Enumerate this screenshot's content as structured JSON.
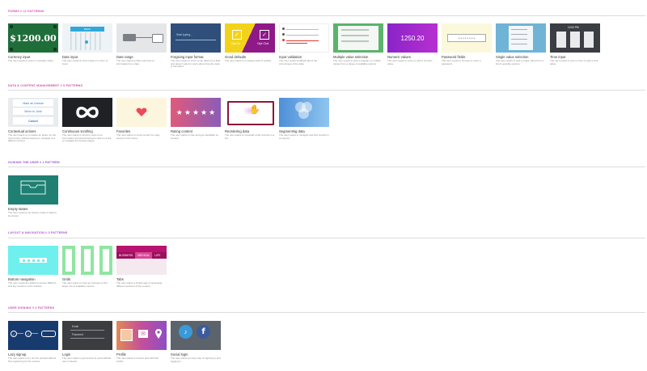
{
  "colors": {
    "section_forms": "#d44fb8",
    "section_data": "#cc4f9e",
    "section_empty": "#9c4ed0",
    "section_layout": "#b04fd0",
    "section_social": "#cc4fb8",
    "rule": "#dcdcdc"
  },
  "sections": {
    "forms": {
      "title": "FORMS // 11 PATTERNS",
      "cards": [
        {
          "title": "Currency input",
          "desc": "The user needs to enter a monetary value.",
          "thumb_text": "$1200.00"
        },
        {
          "title": "Date input",
          "desc": "The user needs to pick a date on a form or input.",
          "thumb_text": "March"
        },
        {
          "title": "Date range",
          "desc": "The user wants to filter and look up information by a date.",
          "thumb_text": ""
        },
        {
          "title": "Forgiving input format",
          "desc": "The user needs to enter some data into a field and doesn't want to worry about how the data is formatted.",
          "thumb_text": "Start typing..."
        },
        {
          "title": "Good defaults",
          "desc": "The user wants to complete actions quickly.",
          "thumb_left": "Opt-in",
          "thumb_right": "Opt Out"
        },
        {
          "title": "Input validation",
          "desc": "The user needs feedback about the correctness of the data.",
          "thumb_text": ""
        },
        {
          "title": "Multiple value selection",
          "desc": "The user needs to pick a singular or multiple values from a range of available options.",
          "thumb_text": ""
        },
        {
          "title": "Numeric values",
          "desc": "The user needs to enter or pick a numeric value.",
          "thumb_text": "1250.20"
        },
        {
          "title": "Password fields",
          "desc": "The user needs to choose or enter a password.",
          "thumb_text": "* * * * * * * *"
        },
        {
          "title": "Single value selection",
          "desc": "The user needs to pick a single value from a list of possible options.",
          "thumb_text": ""
        },
        {
          "title": "Time input",
          "desc": "The user needs to enter a time or pick a time value.",
          "thumb_text": "12:00 PM"
        }
      ]
    },
    "data": {
      "title": "DATA & CONTENT MANAGEMENT // 6 PATTERNS",
      "cards": [
        {
          "title": "Contextual actions",
          "desc": "The user wants to complete an action on the current item without leaving or navigate to a different screen.",
          "menu": [
            "Mark as Unread",
            "Move to Junk",
            "Cancel"
          ]
        },
        {
          "title": "Continuous scrolling",
          "desc": "The user wants to scroll to view more information and avoid having to click on a link or navigate the browse pages.",
          "thumb_text": ""
        },
        {
          "title": "Favorites",
          "desc": "The user wants to mark content for easy access in the future.",
          "thumb_text": ""
        },
        {
          "title": "Rating content",
          "desc": "The user wants to rate and give feedback on content.",
          "thumb_text": ""
        },
        {
          "title": "Reordering data",
          "desc": "The user wants to manually order records in a list.",
          "thumb_text": ""
        },
        {
          "title": "Segmenting data",
          "desc": "The user needs to navigate and find records in a long list.",
          "thumb_text": ""
        }
      ]
    },
    "empty": {
      "title": "GUIDING THE USER // 1 PATTERN",
      "cards": [
        {
          "title": "Empty states",
          "desc": "The user needs to be shown a lack of data to be shown.",
          "thumb_text": ""
        }
      ]
    },
    "layout": {
      "title": "LAYOUT & NAVIGATION // 3 PATTERNS",
      "cards": [
        {
          "title": "Bottom navigation",
          "desc": "The user needs the ability to access different and key sections of the website.",
          "thumb_text": ""
        },
        {
          "title": "Grids",
          "desc": "The user wants to view an overview of the larger set of available content.",
          "thumb_text": ""
        },
        {
          "title": "Tabs",
          "desc": "The user wants a simple way of accessing different sections of the content.",
          "tabs": [
            "BUSINESS",
            "MEDICAL",
            "LIFE"
          ]
        }
      ]
    },
    "social": {
      "title": "USER SIGNING // 4 PATTERNS",
      "cards": [
        {
          "title": "Lazy signup",
          "desc": "The user wants to try out the product without first registering for the service.",
          "thumb_text": ""
        },
        {
          "title": "Login",
          "desc": "The user wants to get access to personalized user contents.",
          "field1": "Email",
          "field2": "Password"
        },
        {
          "title": "Profile",
          "desc": "The user wants to access and edit their profile.",
          "thumb_text": ""
        },
        {
          "title": "Social login",
          "desc": "The user wants an easy way of signing up and logging in.",
          "thumb_text": ""
        }
      ]
    }
  }
}
